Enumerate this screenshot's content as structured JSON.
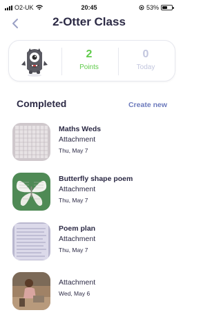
{
  "status_bar": {
    "carrier": "O2-UK",
    "time": "20:45",
    "battery": "53%",
    "battery_level": 0.53
  },
  "header": {
    "title": "2-Otter Class",
    "back_icon": "chevron-left-icon"
  },
  "points_card": {
    "points_value": "2",
    "points_label": "Points",
    "today_value": "0",
    "today_label": "Today",
    "points_color": "#5fcb4a",
    "today_color": "#c2c6de"
  },
  "section": {
    "title": "Completed",
    "create_new": "Create new",
    "create_new_color": "#6d7bbd"
  },
  "posts": [
    {
      "title": "Maths Weds",
      "type": "Attachment",
      "date": "Thu, May 7"
    },
    {
      "title": "Butterfly shape poem",
      "type": "Attachment",
      "date": "Thu, May 7"
    },
    {
      "title": "Poem plan",
      "type": "Attachment",
      "date": "Thu, May 7"
    },
    {
      "title": "",
      "type": "Attachment",
      "date": "Wed, May 6"
    }
  ]
}
